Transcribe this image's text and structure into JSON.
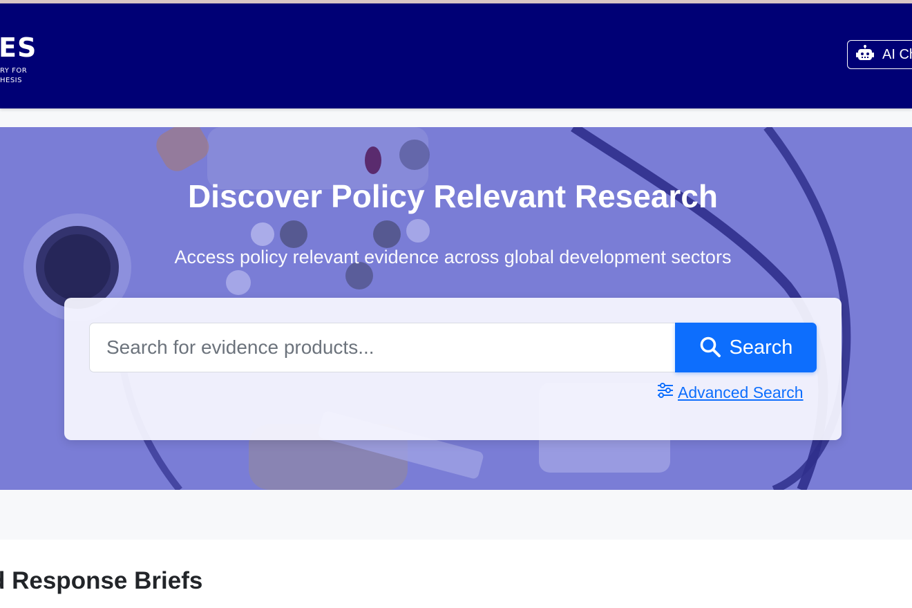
{
  "header": {
    "logo_main": "ES",
    "logo_sub_line1": "RY FOR",
    "logo_sub_line2": "HESIS",
    "ai_button": {
      "label": "AI Ch",
      "icon": "robot-icon"
    },
    "background_color": "#000075"
  },
  "hero": {
    "title": "Discover Policy Relevant Research",
    "subtitle": "Access policy relevant evidence across global development sectors",
    "background_color": "#7a7dd6",
    "search": {
      "placeholder": "Search for evidence products...",
      "value": "",
      "button_label": "Search",
      "button_icon": "search-icon",
      "button_color": "#0d6efd"
    },
    "advanced_search": {
      "label": "Advanced Search",
      "icon": "sliders-icon"
    }
  },
  "section": {
    "heading": "d Response Briefs"
  }
}
